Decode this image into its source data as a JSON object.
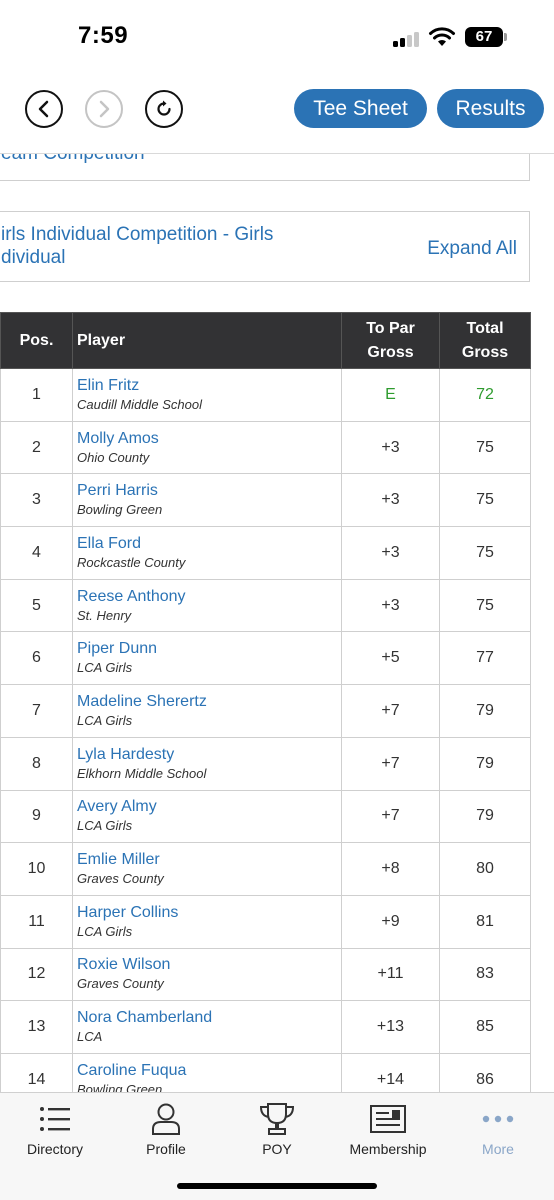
{
  "status_bar": {
    "time": "7:59",
    "battery": "67"
  },
  "nav": {
    "tee_sheet_label": "Tee Sheet",
    "results_label": "Results"
  },
  "competitions": [
    {
      "title": "eam Competition"
    },
    {
      "title_line1": "irls Individual Competition - Girls",
      "title_line2": "dividual",
      "expand_label": "Expand All"
    }
  ],
  "table": {
    "headers": {
      "pos": "Pos.",
      "player": "Player",
      "to_par_line1": "To Par",
      "to_par_line2": "Gross",
      "total_line1": "Total",
      "total_line2": "Gross"
    },
    "rows": [
      {
        "pos": "1",
        "name": "Elin Fritz",
        "school": "Caudill Middle School",
        "to_par": "E",
        "total": "72",
        "highlight": true
      },
      {
        "pos": "2",
        "name": "Molly Amos",
        "school": "Ohio County",
        "to_par": "+3",
        "total": "75"
      },
      {
        "pos": "3",
        "name": "Perri Harris",
        "school": "Bowling Green",
        "to_par": "+3",
        "total": "75"
      },
      {
        "pos": "4",
        "name": "Ella Ford",
        "school": "Rockcastle County",
        "to_par": "+3",
        "total": "75"
      },
      {
        "pos": "5",
        "name": "Reese Anthony",
        "school": "St. Henry",
        "to_par": "+3",
        "total": "75"
      },
      {
        "pos": "6",
        "name": "Piper Dunn",
        "school": "LCA Girls",
        "to_par": "+5",
        "total": "77"
      },
      {
        "pos": "7",
        "name": "Madeline Sherertz",
        "school": "LCA Girls",
        "to_par": "+7",
        "total": "79"
      },
      {
        "pos": "8",
        "name": "Lyla Hardesty",
        "school": "Elkhorn Middle School",
        "to_par": "+7",
        "total": "79"
      },
      {
        "pos": "9",
        "name": "Avery Almy",
        "school": "LCA Girls",
        "to_par": "+7",
        "total": "79"
      },
      {
        "pos": "10",
        "name": "Emlie Miller",
        "school": "Graves County",
        "to_par": "+8",
        "total": "80"
      },
      {
        "pos": "11",
        "name": "Harper Collins",
        "school": "LCA Girls",
        "to_par": "+9",
        "total": "81"
      },
      {
        "pos": "12",
        "name": "Roxie Wilson",
        "school": "Graves County",
        "to_par": "+11",
        "total": "83"
      },
      {
        "pos": "13",
        "name": "Nora Chamberland",
        "school": "LCA",
        "to_par": "+13",
        "total": "85"
      },
      {
        "pos": "14",
        "name": "Caroline Fuqua",
        "school": "Bowling Green",
        "to_par": "+14",
        "total": "86"
      }
    ]
  },
  "tabbar": {
    "items": [
      {
        "label": "Directory",
        "icon": "list-icon"
      },
      {
        "label": "Profile",
        "icon": "person-icon"
      },
      {
        "label": "POY",
        "icon": "trophy-icon"
      },
      {
        "label": "Membership",
        "icon": "membership-card-icon"
      },
      {
        "label": "More",
        "icon": "more-dots-icon"
      }
    ]
  },
  "colors": {
    "accent": "#2b73b5",
    "header_bg": "#323234",
    "leader_green": "#2e9b2e",
    "tab_more": "#8aa6c8"
  }
}
